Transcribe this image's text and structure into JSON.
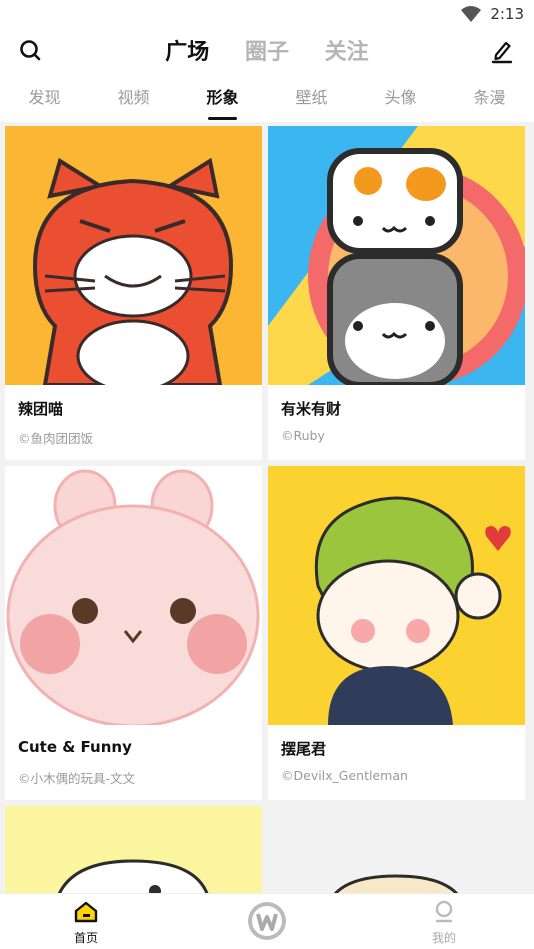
{
  "status": {
    "time": "2:13"
  },
  "header": {
    "tabs": [
      "广场",
      "圈子",
      "关注"
    ],
    "active_tab": "广场"
  },
  "subtabs": [
    "发现",
    "视频",
    "形象",
    "壁纸",
    "头像",
    "条漫"
  ],
  "cards": [
    {
      "title": "辣团喵",
      "author": "©鱼肉团团饭"
    },
    {
      "title": "有米有财",
      "author": "©Ruby"
    },
    {
      "title": "Cute & Funny",
      "author": "©小木偶的玩具-文文"
    },
    {
      "title": "摆尾君",
      "author": "©Devilx_Gentleman"
    }
  ],
  "bottom_nav": {
    "home": "首页",
    "mine": "我的"
  },
  "colors": {
    "accent": "#111111",
    "inactive": "#b5b5b5",
    "yellow_icon": "#ffd400"
  }
}
